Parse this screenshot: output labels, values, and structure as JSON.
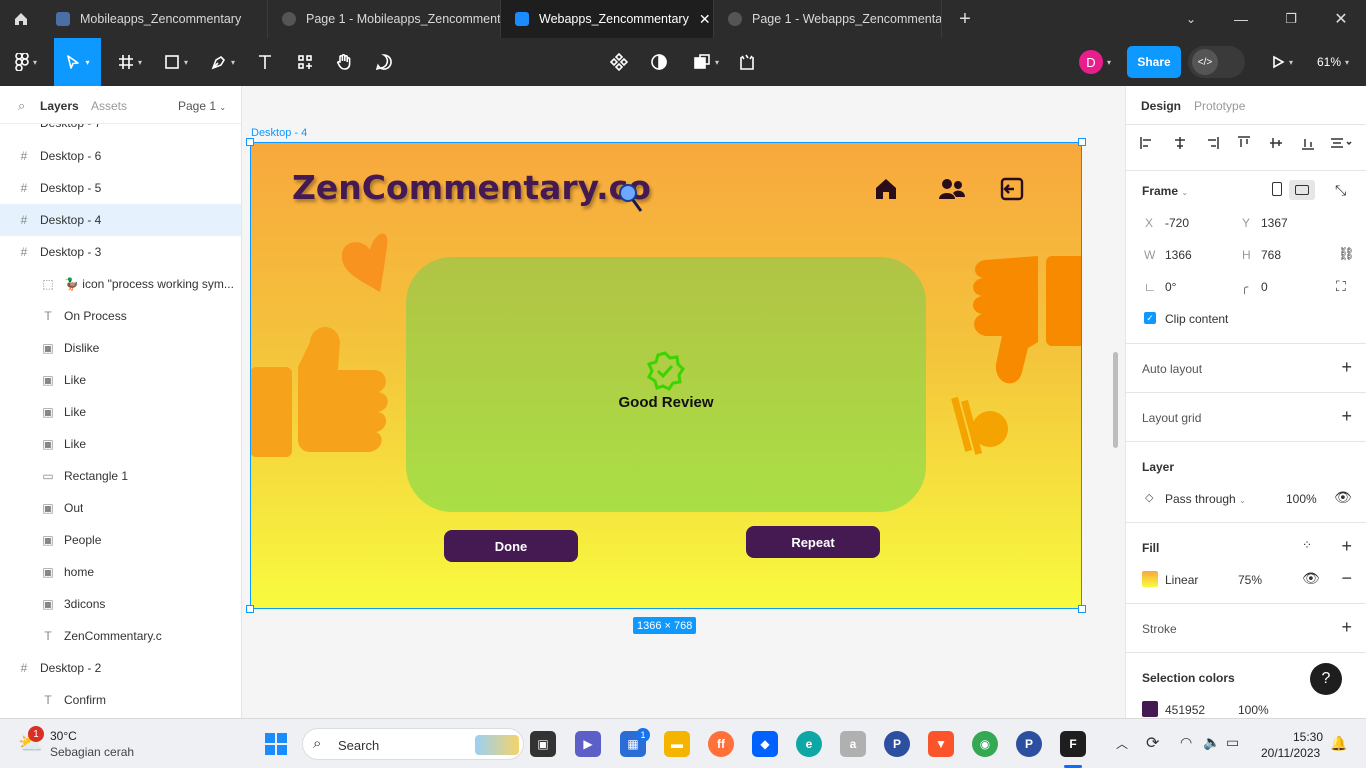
{
  "tabs": [
    {
      "label": "Mobileapps_Zencommentary"
    },
    {
      "label": "Page 1 - Mobileapps_Zencommentary"
    },
    {
      "label": "Webapps_Zencommentary"
    },
    {
      "label": "Page 1 - Webapps_Zencommentary"
    }
  ],
  "toolbar": {
    "avatar": "D",
    "share": "Share",
    "zoom": "61%"
  },
  "left": {
    "tabs": {
      "layers": "Layers",
      "assets": "Assets",
      "page": "Page 1"
    },
    "layers": [
      {
        "label": "Desktop - 6",
        "icon": "#"
      },
      {
        "label": "Desktop - 5",
        "icon": "#"
      },
      {
        "label": "Desktop - 4",
        "icon": "#"
      },
      {
        "label": "Desktop - 3",
        "icon": "#"
      },
      {
        "label": "🦆 icon \"process working sym...",
        "icon": "⬚"
      },
      {
        "label": "On Process",
        "icon": "T"
      },
      {
        "label": "Dislike",
        "icon": "▣"
      },
      {
        "label": "Like",
        "icon": "▣"
      },
      {
        "label": "Like",
        "icon": "▣"
      },
      {
        "label": "Like",
        "icon": "▣"
      },
      {
        "label": "Rectangle 1",
        "icon": "▭"
      },
      {
        "label": "Out",
        "icon": "▣"
      },
      {
        "label": "People",
        "icon": "▣"
      },
      {
        "label": "home",
        "icon": "▣"
      },
      {
        "label": "3dicons",
        "icon": "▣"
      },
      {
        "label": "ZenCommentary.c",
        "icon": "T"
      },
      {
        "label": "Desktop - 2",
        "icon": "#"
      },
      {
        "label": "Confirm",
        "icon": "T"
      }
    ]
  },
  "canvas": {
    "frame_label": "Desktop - 4",
    "size_badge": "1366 × 768",
    "logo": "ZenCommentary.co",
    "card_text": "Good Review",
    "done": "Done",
    "repeat": "Repeat"
  },
  "right": {
    "tabs": {
      "design": "Design",
      "prototype": "Prototype"
    },
    "frame": "Frame",
    "x_label": "X",
    "x": "-720",
    "y_label": "Y",
    "y": "1367",
    "w_label": "W",
    "w": "1366",
    "h_label": "H",
    "h": "768",
    "rotation": "0°",
    "radius": "0",
    "clip": "Clip content",
    "auto_layout": "Auto layout",
    "layout_grid": "Layout grid",
    "layer": "Layer",
    "blend": "Pass through",
    "layer_opacity": "100%",
    "fill": "Fill",
    "fill_type": "Linear",
    "fill_opacity": "75%",
    "stroke": "Stroke",
    "selection_colors": "Selection colors",
    "sel_hex": "451952",
    "sel_opacity": "100%"
  },
  "taskbar": {
    "temp": "30°C",
    "weather": "Sebagian cerah",
    "search": "Search",
    "time": "15:30",
    "date": "20/11/2023",
    "weather_badge": "1",
    "store_badge": "1"
  },
  "colors": {
    "accent": "#0d99ff",
    "brand": "#451952",
    "chrome": "#2c2c2c"
  }
}
